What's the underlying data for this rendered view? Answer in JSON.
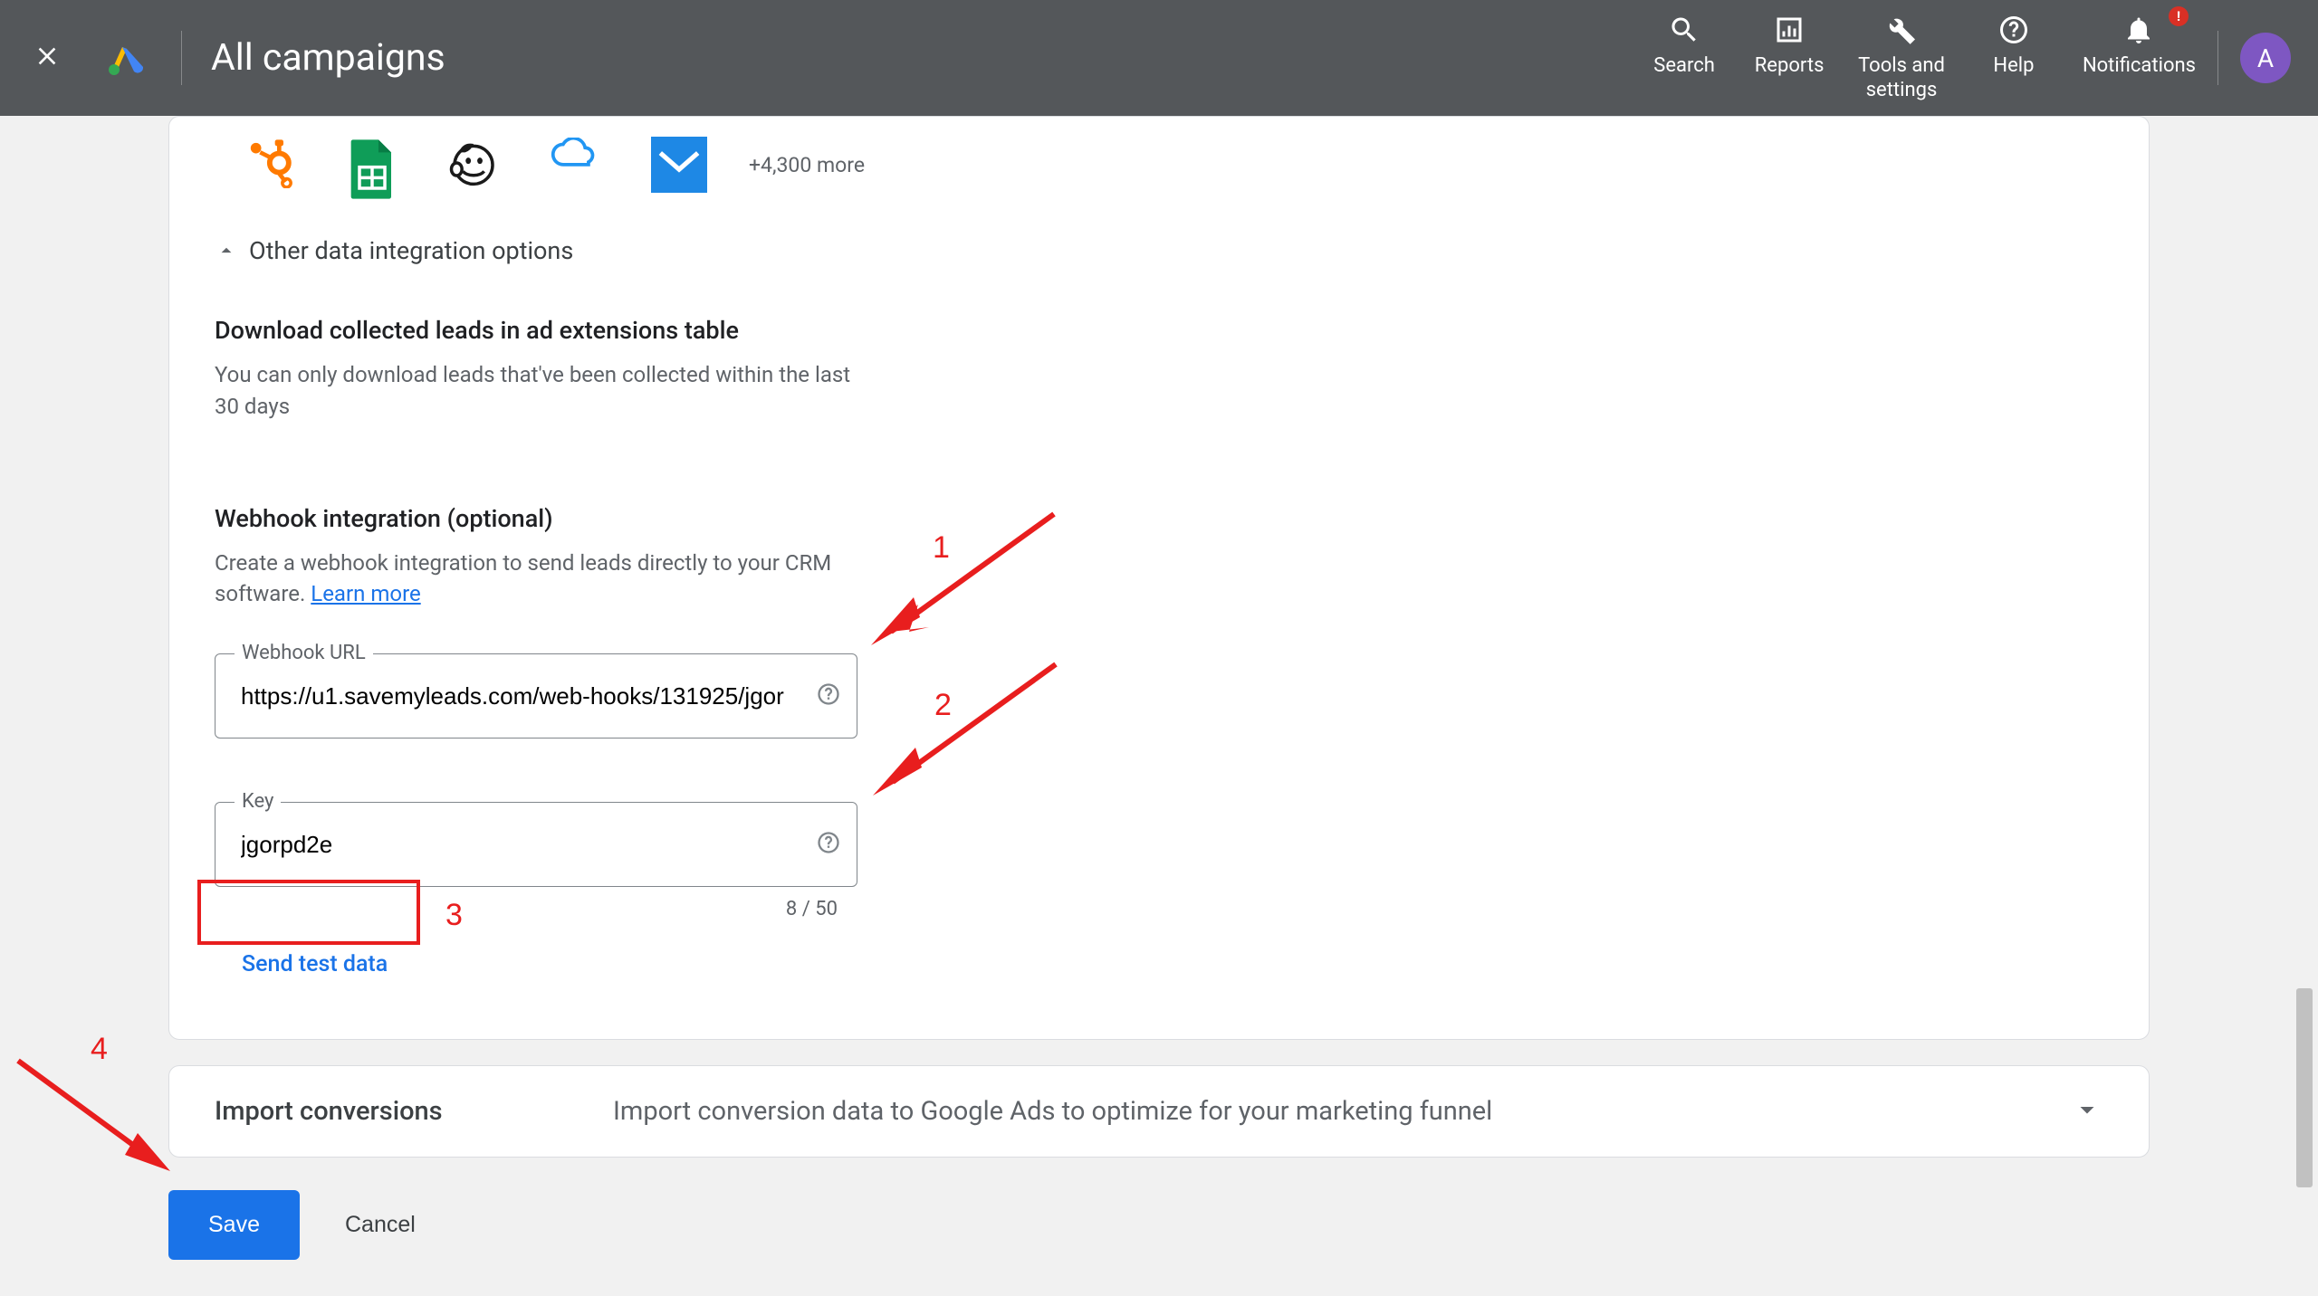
{
  "header": {
    "title": "All campaigns",
    "nav": {
      "search": "Search",
      "reports": "Reports",
      "tools": "Tools and\nsettings",
      "help": "Help",
      "notifications": "Notifications",
      "badge": "!"
    },
    "avatar": "A"
  },
  "integrations": {
    "more": "+4,300 more",
    "expand_label": "Other data integration options"
  },
  "download": {
    "title": "Download collected leads in ad extensions table",
    "desc": "You can only download leads that've been collected within the last 30 days"
  },
  "webhook": {
    "title": "Webhook integration (optional)",
    "desc_pre": "Create a webhook integration to send leads directly to your CRM software. ",
    "learn_more": "Learn more",
    "url_label": "Webhook URL",
    "url_value": "https://u1.savemyleads.com/web-hooks/131925/jgor",
    "key_label": "Key",
    "key_value": "jgorpd2e",
    "counter": "8 / 50",
    "send_test": "Send test data"
  },
  "import_conv": {
    "title": "Import conversions",
    "desc": "Import conversion data to Google Ads to optimize for your marketing funnel"
  },
  "actions": {
    "save": "Save",
    "cancel": "Cancel"
  },
  "annotations": {
    "n1": "1",
    "n2": "2",
    "n3": "3",
    "n4": "4"
  }
}
